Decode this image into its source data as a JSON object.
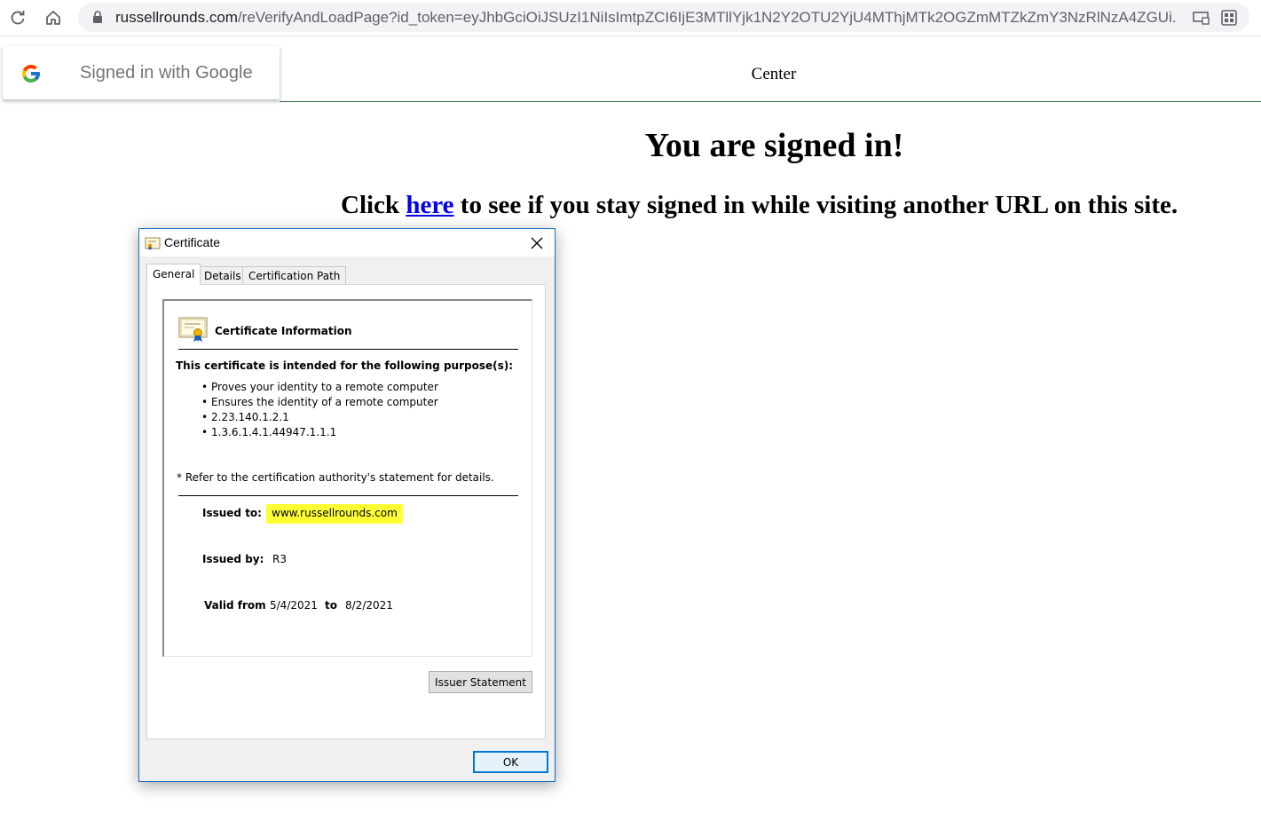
{
  "browser": {
    "url_host": "russellrounds.com",
    "url_path": "/reVerifyAndLoadPage?id_token=eyJhbGciOiJSUzI1NiIsImtpZCI6IjE3MTllYjk1N2Y2OTU2YjU4MThjMTk2OGZmMTZkZmY3NzRlNzA4ZGUi..."
  },
  "page": {
    "signin_badge": "Signed in with Google",
    "center_label": "Center",
    "headline": "You are signed in!",
    "subline_before": "Click ",
    "subline_link": "here",
    "subline_after": " to see if you stay signed in while visiting another URL on this site."
  },
  "dialog": {
    "title": "Certificate",
    "tabs": [
      "General",
      "Details",
      "Certification Path"
    ],
    "info_heading": "Certificate Information",
    "purpose_heading": "This certificate is intended for the following purpose(s):",
    "purposes": [
      "Proves your identity to a remote computer",
      "Ensures the identity of a remote computer",
      "2.23.140.1.2.1",
      "1.3.6.1.4.1.44947.1.1.1"
    ],
    "refer_note": "* Refer to the certification authority's statement for details.",
    "issued_to_label": "Issued to:",
    "issued_to_value": "www.russellrounds.com",
    "issued_by_label": "Issued by:",
    "issued_by_value": "R3",
    "valid_from_label": "Valid from",
    "valid_from_value": "5/4/2021",
    "valid_to_label": "to",
    "valid_to_value": "8/2/2021",
    "issuer_statement_button": "Issuer Statement",
    "ok_button": "OK"
  },
  "icons": {
    "reload": "reload-icon",
    "home": "home-icon",
    "lock": "lock-icon",
    "cast": "cast-icon",
    "extensions": "extensions-icon",
    "google": "google-logo-icon",
    "certificate": "certificate-icon",
    "close": "close-icon"
  },
  "colors": {
    "link": "#0000ee",
    "highlight": "#ffff33",
    "dialog_accent": "#0078d7",
    "rule_green": "#2f6a3a"
  }
}
